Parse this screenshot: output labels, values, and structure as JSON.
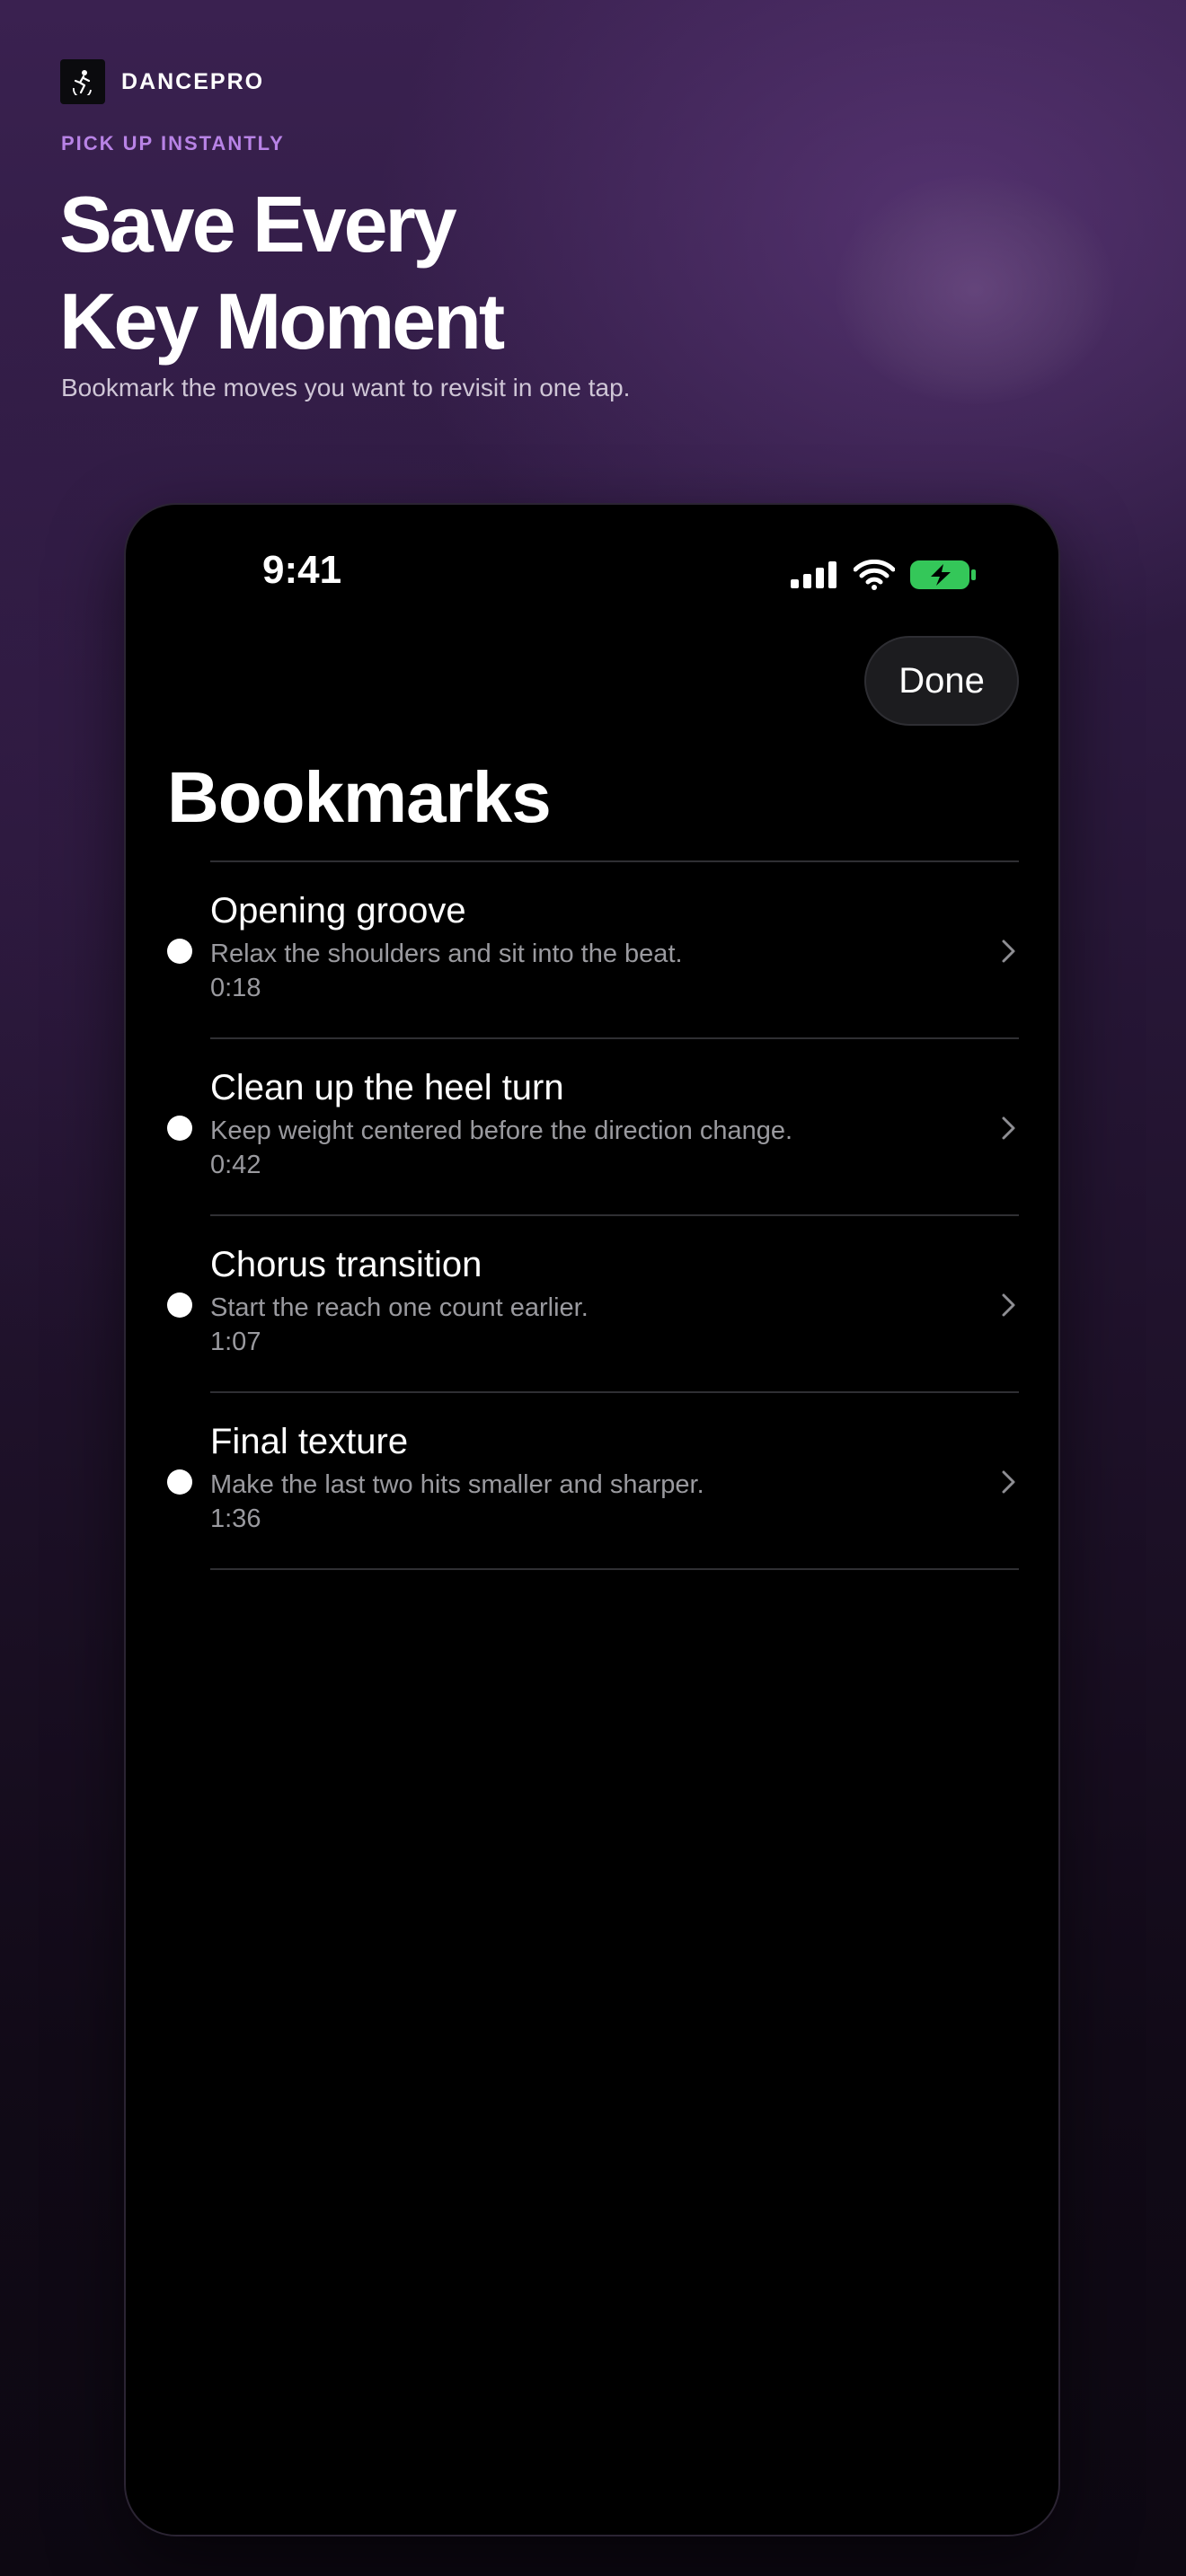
{
  "brand": {
    "name": "DANCEPRO",
    "logo_icon": "dancer-icon"
  },
  "hero": {
    "eyebrow": "PICK UP INSTANTLY",
    "headline_line1": "Save Every",
    "headline_line2": "Key Moment",
    "subhead": "Bookmark the moves you want to revisit in one tap."
  },
  "status_bar": {
    "time": "9:41",
    "icons": [
      "cellular-signal-icon",
      "wifi-icon",
      "battery-charging-icon"
    ]
  },
  "screen": {
    "done_label": "Done",
    "title": "Bookmarks"
  },
  "bookmarks": [
    {
      "title": "Opening groove",
      "note": "Relax the shoulders and sit into the beat.",
      "time": "0:18"
    },
    {
      "title": "Clean up the heel turn",
      "note": "Keep weight centered before the direction change.",
      "time": "0:42"
    },
    {
      "title": "Chorus transition",
      "note": "Start the reach one count earlier.",
      "time": "1:07"
    },
    {
      "title": "Final texture",
      "note": "Make the last two hits smaller and sharper.",
      "time": "1:36"
    }
  ],
  "colors": {
    "accent": "#b883e6",
    "battery": "#34c759",
    "background_top": "#3a2150",
    "background_bottom": "#0d0812"
  }
}
